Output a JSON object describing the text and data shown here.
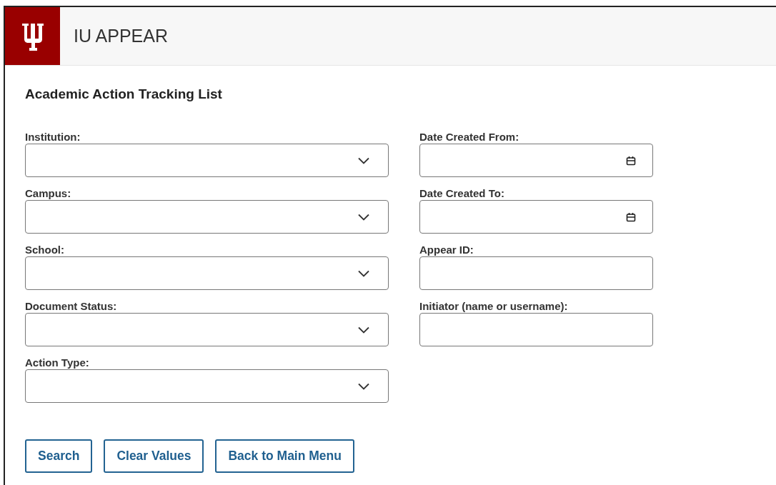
{
  "header": {
    "app_name": "IU APPEAR"
  },
  "page_title": "Academic Action Tracking List",
  "left_fields": [
    {
      "label": "Institution:",
      "kind": "select"
    },
    {
      "label": "Campus:",
      "kind": "select"
    },
    {
      "label": "School:",
      "kind": "select"
    },
    {
      "label": "Document Status:",
      "kind": "select"
    },
    {
      "label": "Action Type:",
      "kind": "select"
    }
  ],
  "right_fields": [
    {
      "label": "Date Created From:",
      "kind": "date"
    },
    {
      "label": "Date Created To:",
      "kind": "date"
    },
    {
      "label": "Appear ID:",
      "kind": "text"
    },
    {
      "label": "Initiator (name or username):",
      "kind": "text"
    }
  ],
  "buttons": [
    "Search",
    "Clear Values",
    "Back to Main Menu"
  ]
}
